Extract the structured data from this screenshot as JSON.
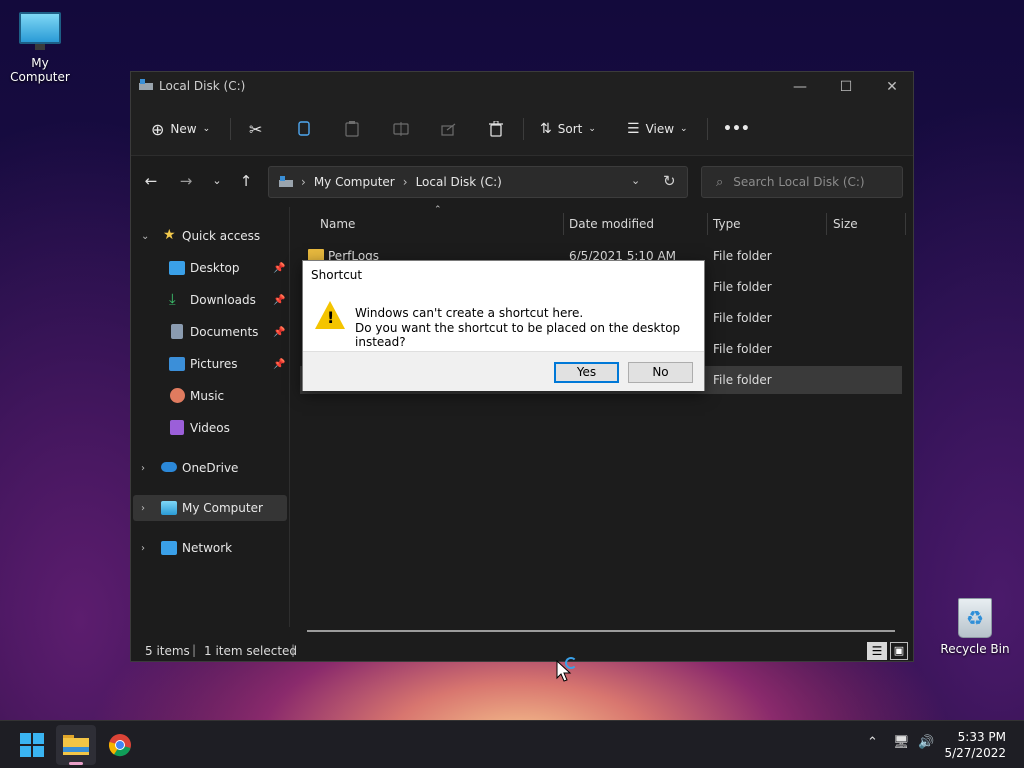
{
  "desktop": {
    "icons": [
      {
        "label": "My Computer"
      },
      {
        "label": "Recycle Bin"
      }
    ]
  },
  "window": {
    "title": "Local Disk (C:)",
    "controls": {
      "minimize": "—",
      "maximize": "☐",
      "close": "✕"
    },
    "command_bar": {
      "new_label": "New",
      "sort_label": "Sort",
      "view_label": "View",
      "more_label": "•••"
    },
    "address": {
      "crumbs": [
        "My Computer",
        "Local Disk (C:)"
      ]
    },
    "search": {
      "placeholder": "Search Local Disk (C:)"
    },
    "sidebar": {
      "quick_access": "Quick access",
      "items": [
        {
          "label": "Desktop",
          "color": "#3aa0e8"
        },
        {
          "label": "Downloads",
          "color": "#3cc46e"
        },
        {
          "label": "Documents",
          "color": "#8a9bb0"
        },
        {
          "label": "Pictures",
          "color": "#3b8fd9"
        },
        {
          "label": "Music",
          "color": "#e07b5f"
        },
        {
          "label": "Videos",
          "color": "#9b5fd9"
        }
      ],
      "onedrive": "OneDrive",
      "my_computer": "My Computer",
      "network": "Network"
    },
    "columns": {
      "name": "Name",
      "date": "Date modified",
      "type": "Type",
      "size": "Size"
    },
    "rows": [
      {
        "name": "PerfLogs",
        "date": "6/5/2021 5:10 AM",
        "type": "File folder"
      },
      {
        "name": "",
        "date": "",
        "type": "File folder"
      },
      {
        "name": "",
        "date": "",
        "type": "File folder"
      },
      {
        "name": "",
        "date": "",
        "type": "File folder"
      },
      {
        "name": "",
        "date": "",
        "type": "File folder"
      }
    ],
    "status": {
      "items": "5 items",
      "selected": "1 item selected"
    }
  },
  "dialog": {
    "title": "Shortcut",
    "line1": "Windows can't create a shortcut here.",
    "line2": "Do you want the shortcut to be placed on the desktop instead?",
    "yes": "Yes",
    "no": "No"
  },
  "taskbar": {
    "time": "5:33 PM",
    "date": "5/27/2022"
  }
}
